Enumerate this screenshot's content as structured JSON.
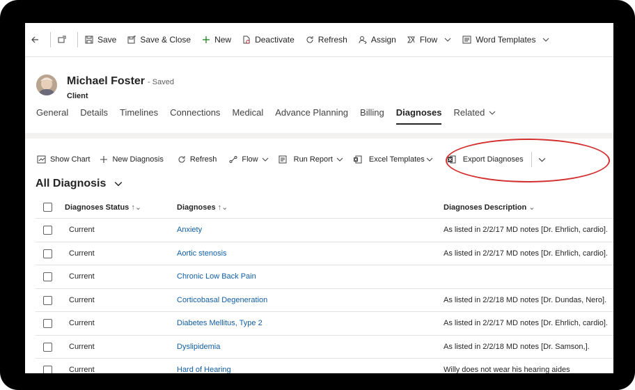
{
  "commandbar": {
    "save": "Save",
    "save_close": "Save & Close",
    "new": "New",
    "deactivate": "Deactivate",
    "refresh": "Refresh",
    "assign": "Assign",
    "flow": "Flow",
    "word_templates": "Word Templates"
  },
  "record": {
    "name": "Michael Foster",
    "status": "- Saved",
    "entity": "Client"
  },
  "tabs": [
    "General",
    "Details",
    "Timelines",
    "Connections",
    "Medical",
    "Advance Planning",
    "Billing",
    "Diagnoses",
    "Related"
  ],
  "active_tab": "Diagnoses",
  "subgrid_toolbar": {
    "show_chart": "Show Chart",
    "new_diagnosis": "New Diagnosis",
    "refresh": "Refresh",
    "flow": "Flow",
    "run_report": "Run Report",
    "excel_templates": "Excel Templates",
    "export_diagnoses": "Export Diagnoses"
  },
  "view": {
    "title": "All Diagnosis"
  },
  "grid": {
    "columns": [
      "Diagnoses Status",
      "Diagnoses",
      "Diagnoses Description"
    ],
    "rows": [
      {
        "status": "Current",
        "diagnosis": "Anxiety",
        "description": "As listed in 2/2/17 MD notes [Dr. Ehrlich, cardio]."
      },
      {
        "status": "Current",
        "diagnosis": "Aortic stenosis",
        "description": "As listed in 2/2/17 MD notes [Dr. Ehrlich, cardio]."
      },
      {
        "status": "Current",
        "diagnosis": "Chronic Low Back Pain",
        "description": ""
      },
      {
        "status": "Current",
        "diagnosis": "Corticobasal Degeneration",
        "description": "As listed in 2/2/18 MD notes [Dr. Dundas, Nero]."
      },
      {
        "status": "Current",
        "diagnosis": "Diabetes Mellitus, Type 2",
        "description": "As listed in 2/2/17 MD notes [Dr. Ehrlich, cardio]."
      },
      {
        "status": "Current",
        "diagnosis": "Dyslipidemia",
        "description": "As listed in 2/2/18 MD notes [Dr. Samson,]."
      },
      {
        "status": "Current",
        "diagnosis": "Hard of Hearing",
        "description": "Willy does not wear his hearing aides"
      }
    ]
  },
  "colors": {
    "link": "#115ea3",
    "highlight": "#d32f2f",
    "frame": "#000000"
  }
}
